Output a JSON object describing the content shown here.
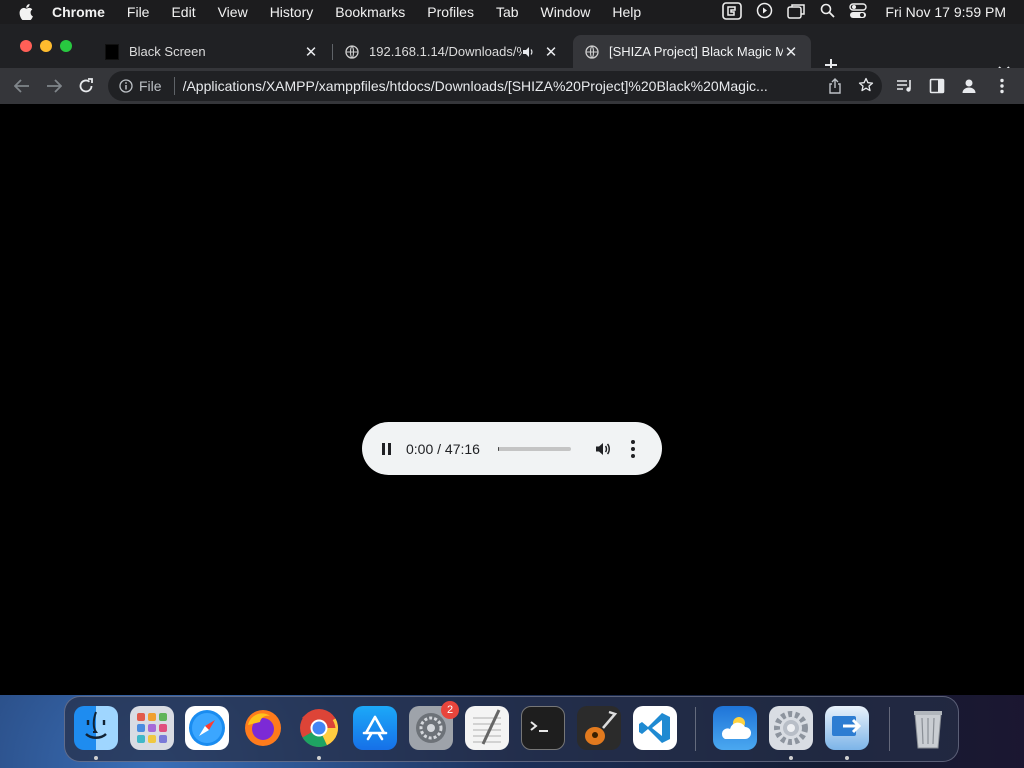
{
  "menubar": {
    "app_name": "Chrome",
    "menus": [
      "File",
      "Edit",
      "View",
      "History",
      "Bookmarks",
      "Profiles",
      "Tab",
      "Window",
      "Help"
    ],
    "clock": "Fri Nov 17  9:59 PM"
  },
  "tabs": [
    {
      "title": "Black Screen",
      "favicon": "black-square-icon"
    },
    {
      "title": "192.168.1.14/Downloads/%",
      "favicon": "globe-icon",
      "audio": true
    },
    {
      "title": "[SHIZA Project] Black Magic M",
      "favicon": "globe-icon",
      "active": true
    }
  ],
  "toolbar": {
    "scheme": "File",
    "url": "/Applications/XAMPP/xamppfiles/htdocs/Downloads/[SHIZA%20Project]%20Black%20Magic..."
  },
  "player": {
    "time": "0:00 / 47:16",
    "progress": 0.02
  },
  "dock": {
    "apps": [
      "Finder",
      "Launchpad",
      "Safari",
      "Firefox",
      "Chrome",
      "App Store",
      "System Preferences",
      "TextEdit",
      "Terminal",
      "GarageBand",
      "Visual Studio Code",
      "Weather",
      "Settings Utility",
      "Migration Assistant",
      "Trash"
    ],
    "badge": "2"
  },
  "colors": {
    "close": "#ff5f57",
    "minimize": "#febc2e",
    "zoom": "#28c840",
    "player_bg": "#f1f3f4"
  }
}
